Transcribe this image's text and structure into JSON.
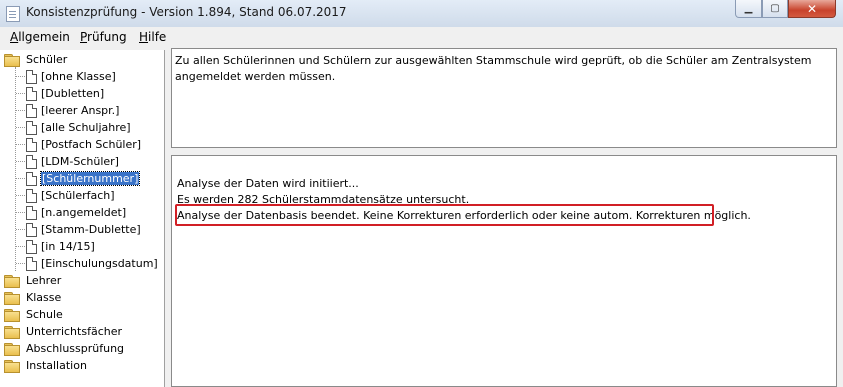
{
  "window": {
    "title": "Konsistenzprüfung - Version 1.894, Stand 06.07.2017",
    "minimize_glyph": "▁",
    "maximize_glyph": "▢",
    "close_glyph": "✕"
  },
  "menu": {
    "items": [
      "Allgemein",
      "Prüfung",
      "Hilfe"
    ]
  },
  "tree": {
    "root_folders": [
      "Schüler",
      "Lehrer",
      "Klasse",
      "Schule",
      "Unterrichtsfächer",
      "Abschlussprüfung",
      "Installation"
    ],
    "schueler_children": [
      "[ohne Klasse]",
      "[Dubletten]",
      "[leerer Anspr.]",
      "[alle Schuljahre]",
      "[Postfach Schüler]",
      "[LDM-Schüler]",
      "[Schülernummer]",
      "[Schülerfach]",
      "[n.angemeldet]",
      "[Stamm-Dublette]",
      "[in 14/15]",
      "[Einschulungsdatum]"
    ],
    "selected": "[Schülernummer]"
  },
  "description": {
    "text": "Zu allen Schülerinnen und Schülern zur ausgewählten Stammschule wird geprüft, ob die Schüler am Zentralsystem angemeldet werden müssen."
  },
  "log": {
    "lines": [
      "Analyse der Daten wird initiiert...",
      " Es werden 282 Schülerstammdatensätze untersucht.",
      "Analyse der Datenbasis beendet. Keine Korrekturen erforderlich oder keine autom. Korrekturen möglich."
    ],
    "highlight_color": "#d11f25"
  }
}
